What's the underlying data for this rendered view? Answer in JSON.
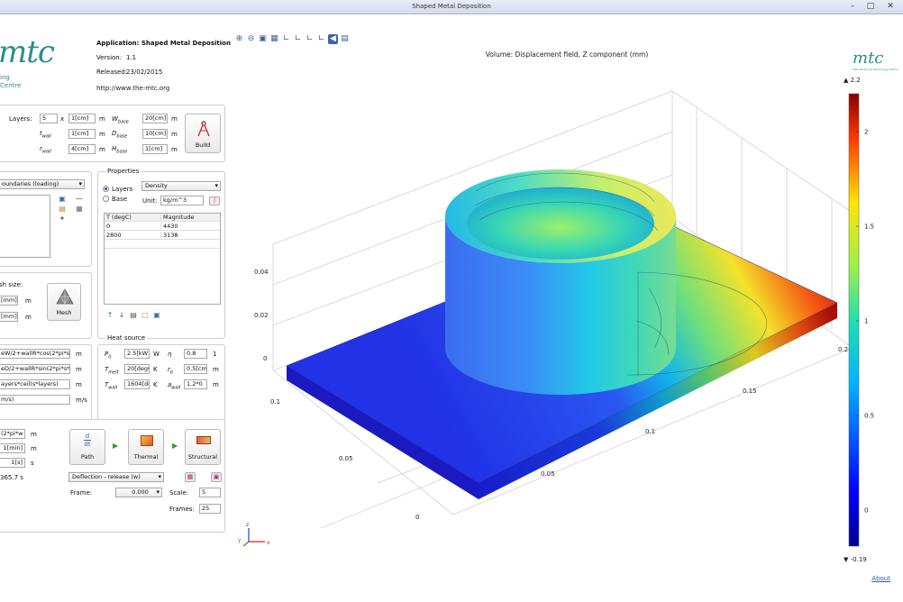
{
  "window": {
    "title": "Shaped Metal Deposition",
    "controls": [
      "–",
      "□",
      "✕"
    ]
  },
  "app": {
    "logo_text": "mtc",
    "logo_sub1": "ing",
    "logo_sub2": "Centre",
    "application": "Application: Shaped Metal Deposition",
    "version_label": "Version:",
    "version": "1.1",
    "released_label": "Released:",
    "released": "23/02/2015",
    "url": "http://www.the-mtc.org"
  },
  "geometry": {
    "layers_label": "Layers:",
    "layers_value": "5",
    "x_sign": "x",
    "layer_height": "1[cm]",
    "m": "m",
    "twall_label": "t",
    "twall_sub": "wall",
    "twall_value": "1[cm]",
    "rwall_label": "r",
    "rwall_sub": "wall",
    "rwall_value": "4[cm]",
    "wbase_label": "W",
    "wbase_sub": "base",
    "wbase_value": "20[cm]",
    "dbase_label": "D",
    "dbase_sub": "base",
    "dbase_value": "10[cm]",
    "hbase_label": "H",
    "hbase_sub": "base",
    "hbase_value": "1[cm]",
    "build_label": "Build"
  },
  "selection": {
    "dropdown": "oundaries (loading)"
  },
  "properties": {
    "title": "Properties",
    "radio_layers": "Layers",
    "radio_base": "Base",
    "property_select": "Density",
    "unit_label": "Unit:",
    "unit_value": "kg/m^3",
    "table_headers": [
      "T (degC)",
      "Magnitude"
    ],
    "table_rows": [
      [
        "0",
        "4430"
      ],
      [
        "2800",
        "3138"
      ]
    ]
  },
  "mesh": {
    "title": "sh size:",
    "max_value": "[mm]",
    "min_value": "[mm]",
    "m": "m",
    "mesh_label": "Mesh"
  },
  "path_exprs": {
    "expr1": "eW/2+wallR*cos(2*pi*s*lay",
    "expr2": "eD/2+wallR*sin(2*pi*s*laye",
    "expr3": "ayers*ceil(s*layers)",
    "expr4": "m/s)",
    "m": "m",
    "ms": "m/s"
  },
  "heat": {
    "title": "Heat source",
    "p0_label": "P",
    "p0_sub": "0",
    "p0_value": "2.5[kW]",
    "p0_unit": "W",
    "eta_label": "η",
    "eta_value": "0.8",
    "eta_unit": "1",
    "tmelt_label": "T",
    "tmelt_sub": "melt",
    "tmelt_value": "20[degC",
    "tmelt_unit": "K",
    "rb_label": "r",
    "rb_sub": "b",
    "rb_value": "0.5[cm]",
    "rb_unit": "m",
    "twall_label": "T",
    "twall_sub": "wall",
    "twall_value": "1604[de",
    "twall_unit": "K",
    "awall_label": "a",
    "awall_sub": "wall",
    "awall_value": "1.2*0",
    "awall_unit": "m"
  },
  "sim": {
    "v1": "(2*pi*w",
    "v2": "1[min]",
    "v3": "1[s]",
    "time": "365.7 s",
    "m": "m",
    "s": "s",
    "path_label": "Path",
    "path_icon": "d\ndt",
    "thermal_label": "Thermal",
    "structural_label": "Structural",
    "result_select": "Deflection - release (w)",
    "frame_label": "Frame:",
    "frame_value": "0.000",
    "scale_label": "Scale:",
    "scale_value": "5",
    "frames_label": "Frames:",
    "frames_value": "25"
  },
  "plot": {
    "title": "Volume: Displacement field, Z component (mm)",
    "logo": "mtc",
    "logo_sub": "Manufacturing Technology Centre",
    "colorbar_max": "▲ 2.2",
    "colorbar_min": "▼ -0.19",
    "colorbar_ticks": [
      {
        "label": "2",
        "value": 2
      },
      {
        "label": "1.5",
        "value": 1.5
      },
      {
        "label": "1",
        "value": 1
      },
      {
        "label": "0.5",
        "value": 0.5
      },
      {
        "label": "0",
        "value": 0
      }
    ],
    "range": [
      -0.19,
      2.2
    ],
    "z_ticks": [
      "0.04",
      "0.02",
      "0"
    ],
    "x_ticks": [
      "0",
      "0.05",
      "0.1",
      "0.15",
      "0.2"
    ],
    "y_ticks": [
      "0.1",
      "0.05",
      "0"
    ],
    "axis_triad": {
      "x": "x",
      "y": "y",
      "z": "z"
    },
    "about": "About"
  }
}
